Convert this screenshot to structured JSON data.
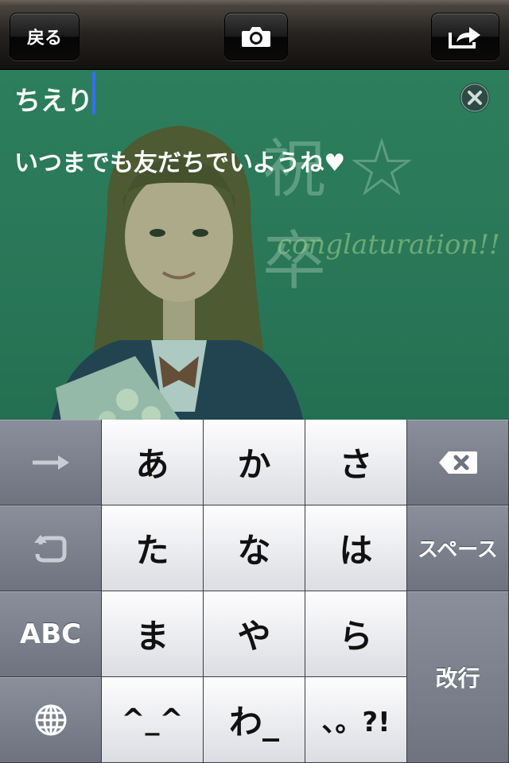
{
  "toolbar": {
    "back_label": "戻る",
    "camera_icon": "camera-icon",
    "share_icon": "share-icon"
  },
  "editor": {
    "name_text": "ちえり",
    "message_text": "いつまでも友だちでいようね♥",
    "clear_icon": "clear-x-icon"
  },
  "background_photo": {
    "board_kanji": "祝☆卒",
    "board_script": "conglaturation!!"
  },
  "keyboard": {
    "row1": {
      "left_icon": "arrow-right-icon",
      "keys": [
        "あ",
        "か",
        "さ"
      ],
      "right_icon": "backspace-icon"
    },
    "row2": {
      "left_icon": "undo-icon",
      "keys": [
        "た",
        "な",
        "は"
      ],
      "right_label": "スペース"
    },
    "row3": {
      "left_label": "ABC",
      "keys": [
        "ま",
        "や",
        "ら"
      ],
      "right_label": "改行"
    },
    "row4": {
      "left_icon": "globe-icon",
      "keys": [
        "^_^",
        "わ_",
        "、。?!"
      ]
    }
  },
  "colors": {
    "cursor": "#3b6cf2",
    "photo_tint": "#2a7055",
    "keyboard_dark": "#6e7380",
    "keyboard_light": "#dcdde2"
  }
}
